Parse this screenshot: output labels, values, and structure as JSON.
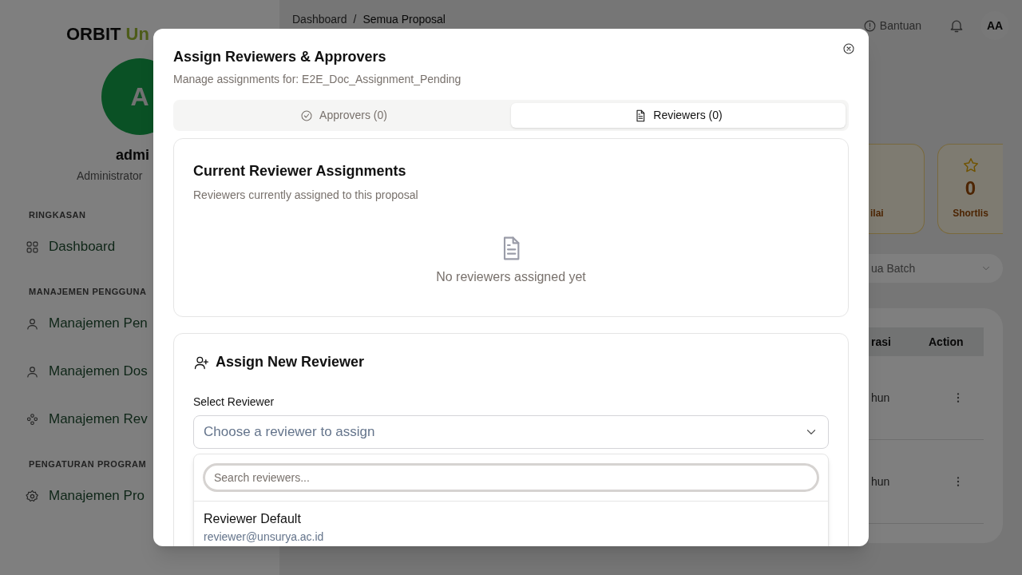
{
  "sidebar": {
    "logo": {
      "text": "ORBIT",
      "accent": "Un"
    },
    "avatar": "A",
    "user_name": "admi",
    "user_role": "Administrator",
    "sections": [
      {
        "title": "RINGKASAN",
        "items": [
          {
            "label": "Dashboard",
            "kind": "grid"
          }
        ]
      },
      {
        "title": "MANAJEMEN PENGGUNA",
        "items": [
          {
            "label": "Manajemen Pen",
            "kind": "user"
          },
          {
            "label": "Manajemen Dos",
            "kind": "user"
          },
          {
            "label": "Manajemen Rev",
            "kind": "group"
          }
        ]
      },
      {
        "title": "PENGATURAN PROGRAM",
        "items": [
          {
            "label": "Manajemen Pro",
            "kind": "gear"
          }
        ]
      }
    ]
  },
  "header": {
    "breadcrumb": [
      "Dashboard",
      "Semua Proposal"
    ],
    "separator": "/",
    "help": "Bantuan",
    "avatar": "AA"
  },
  "stats": [
    {
      "label": "ilai",
      "kind": "partial"
    },
    {
      "value": "0",
      "label": "Shortlis",
      "kind": "star"
    }
  ],
  "filter": {
    "value": "ua Batch"
  },
  "table": {
    "columns": [
      "rasi",
      "Action"
    ],
    "rows": [
      {
        "column_1": "hun"
      },
      {
        "column_1": "hun"
      }
    ]
  },
  "modal": {
    "title": "Assign Reviewers & Approvers",
    "subtitle": "Manage assignments for: E2E_Doc_Assignment_Pending",
    "tabs": [
      {
        "label": "Approvers (0)",
        "selected": false,
        "kind": "check"
      },
      {
        "label": "Reviewers (0)",
        "selected": true,
        "kind": "doc"
      }
    ],
    "current": {
      "title": "Current Reviewer Assignments",
      "subtitle": "Reviewers currently assigned to this proposal",
      "empty": "No reviewers assigned yet"
    },
    "assign": {
      "title": "Assign New Reviewer",
      "field_label": "Select Reviewer",
      "select_placeholder": "Choose a reviewer to assign",
      "search_placeholder": "Search reviewers...",
      "options": [
        {
          "name": "Reviewer Default",
          "email": "reviewer@unsurya.ac.id"
        }
      ]
    }
  }
}
